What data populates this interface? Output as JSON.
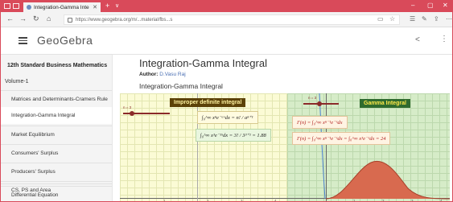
{
  "browser": {
    "tab_title": "Integration-Gamma Inte",
    "tab_close": "✕",
    "tab_add": "+",
    "tab_list": "∨",
    "url": "https://www.geogebra.org/m/...material/fbs...s",
    "window_controls": [
      "–",
      "▢",
      "✕"
    ]
  },
  "header": {
    "logo": "GeoGebra"
  },
  "sidebar": {
    "book_title": "12th Standard Business Mathematics",
    "volume": "Volume-1",
    "items": [
      {
        "label": "Matrices and Determinants-Cramers Rule"
      },
      {
        "label": "Integration-Gamma Integral"
      },
      {
        "label": "Market Equilibrium"
      },
      {
        "label": "Consumers' Surplus"
      },
      {
        "label": "Producers' Surplus"
      },
      {
        "label": "CS, PS and Area"
      },
      {
        "label": "Differential Equation"
      }
    ]
  },
  "main": {
    "title": "Integration-Gamma Integral",
    "author_label": "Author:",
    "author_name": "D.Vasu Raj",
    "subtitle": "Integration-Gamma Integral"
  },
  "applet": {
    "left_banner": "Improper definite integral",
    "right_banner": "Gamma Integral",
    "slider_label": "n = 3",
    "right_slider_label": "n = 3",
    "formula1": "∫₀^∞ xⁿe⁻ᵃˣdx = n! / aⁿ⁺¹",
    "formula2": "∫₀^∞ x³e⁻³ˣdx = 3! / 3³⁺¹ = 1.88",
    "formula3": "Γ(n) = ∫₀^∞ xⁿ⁻¹e⁻ˣdx",
    "formula4": "Γ(n) = ∫₀^∞ xⁿ⁻¹e⁻ˣdx = ∫₀^∞ x³e⁻ˣdx = 24",
    "ticks_left": [
      "1",
      "2",
      "3",
      "4"
    ],
    "ticks_right": [
      "1",
      "2",
      "3",
      "4"
    ],
    "colors": {
      "left_bg": "#fbfbd5",
      "right_bg": "#d6ecc8",
      "curve": "#d86a4f",
      "slider": "#8b2a2a"
    }
  }
}
